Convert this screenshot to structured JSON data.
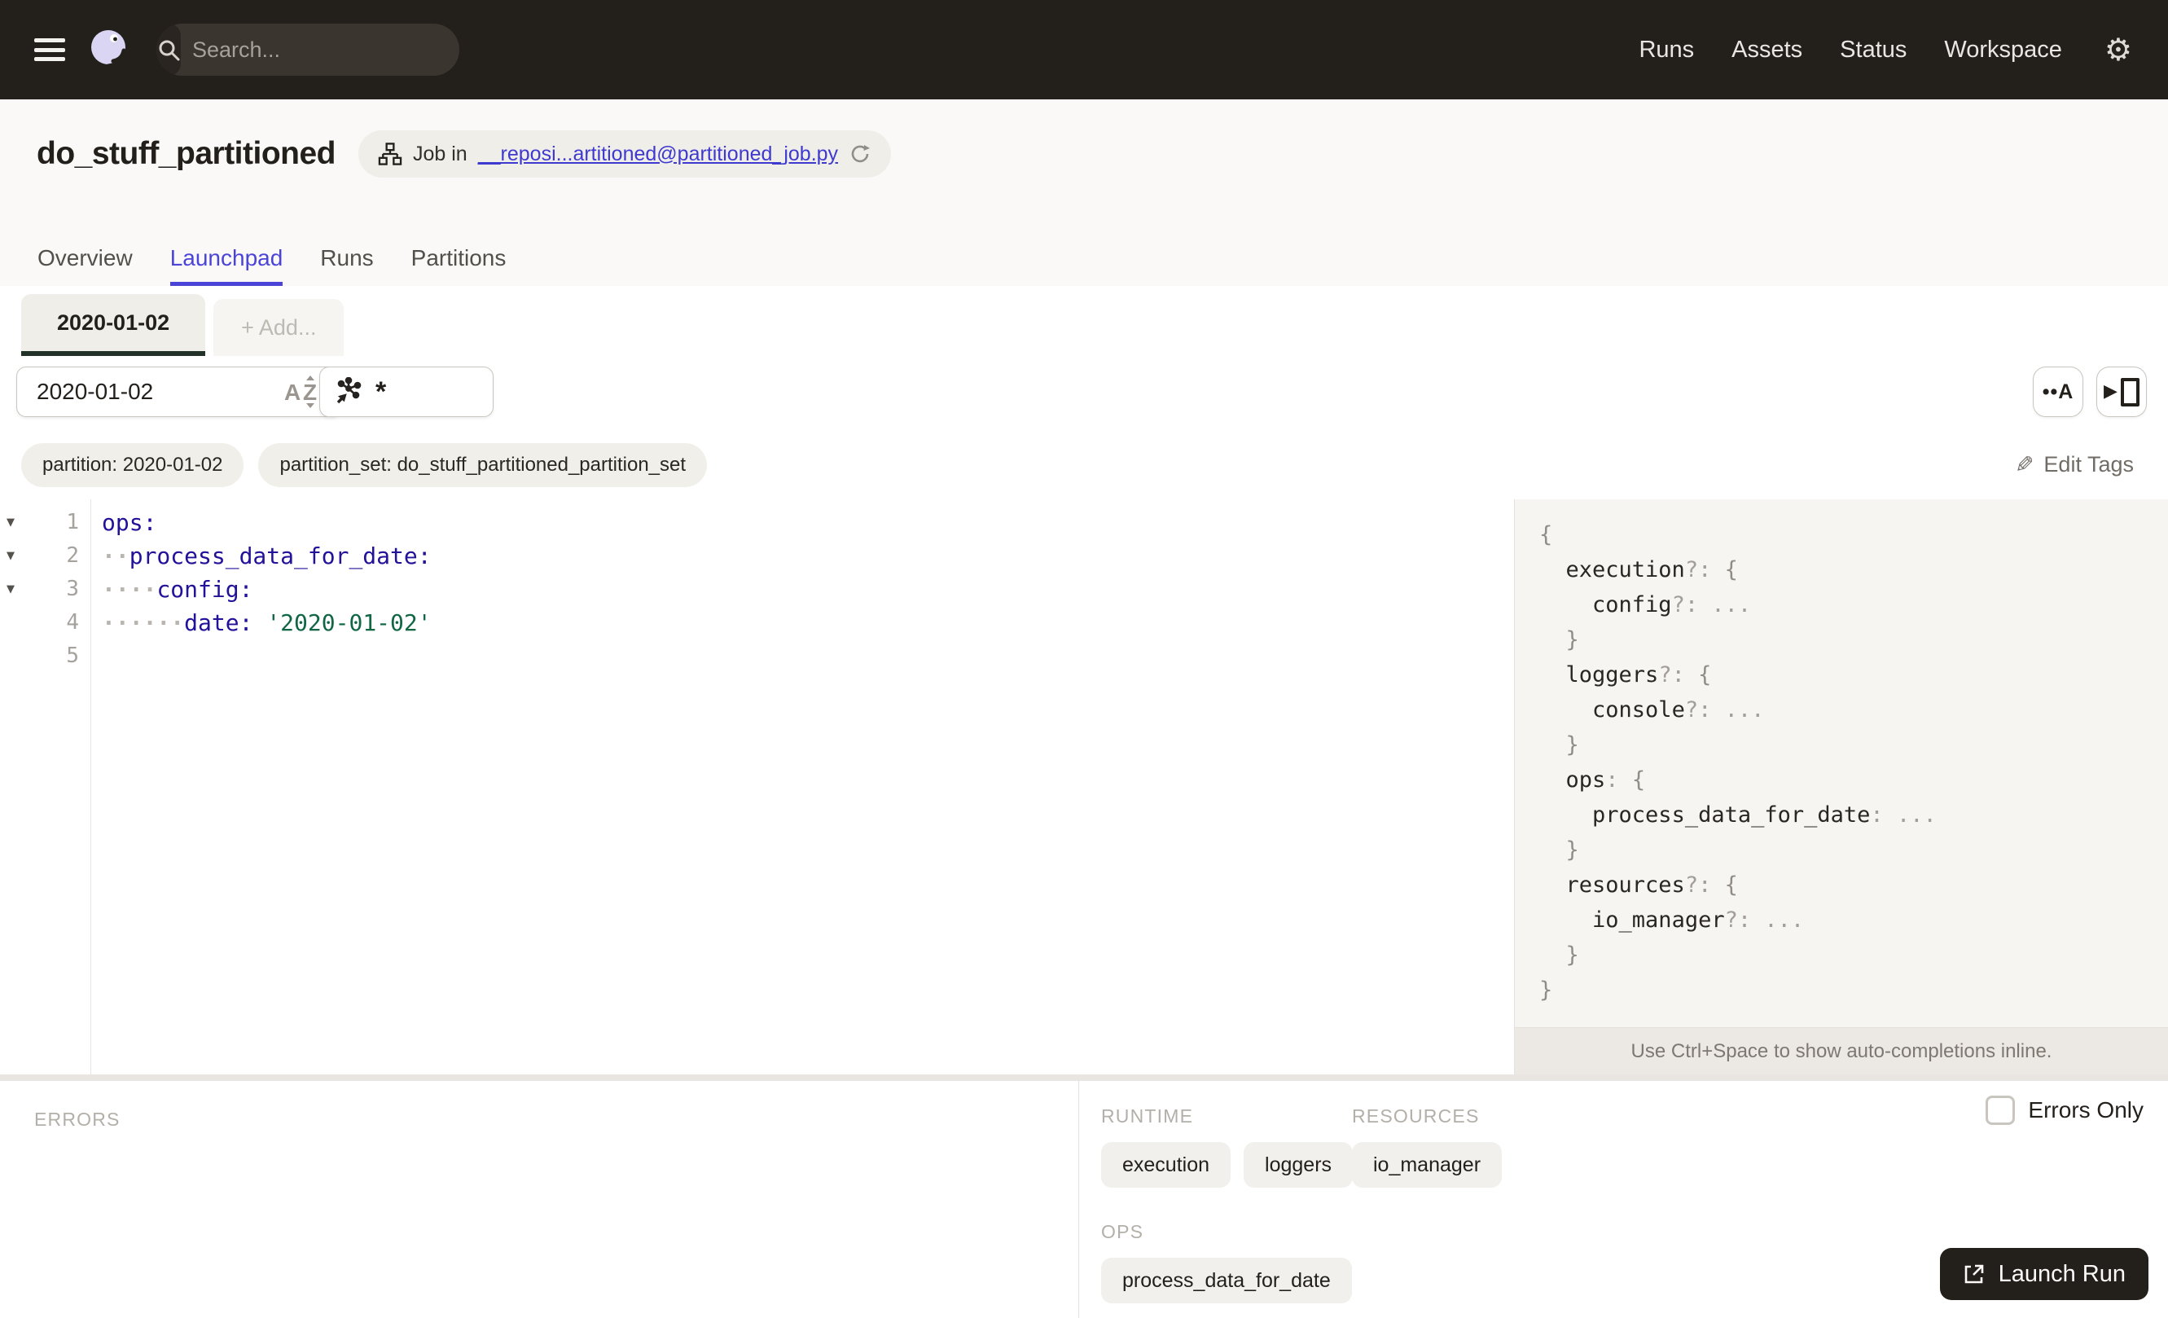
{
  "topnav": {
    "search_placeholder": "Search...",
    "search_shortcut": "/",
    "links": [
      "Runs",
      "Assets",
      "Status",
      "Workspace"
    ]
  },
  "header": {
    "title": "do_stuff_partitioned",
    "job_pill": {
      "prefix": "Job in",
      "link": "__reposi...artitioned@partitioned_job.py"
    },
    "tabs": [
      {
        "label": "Overview"
      },
      {
        "label": "Launchpad"
      },
      {
        "label": "Runs"
      },
      {
        "label": "Partitions"
      }
    ]
  },
  "launchpad": {
    "config_tab": "2020-01-02",
    "add_tab": "+ Add...",
    "partition_select": "2020-01-02",
    "op_select": "*",
    "tags": [
      "partition: 2020-01-02",
      "partition_set: do_stuff_partitioned_partition_set"
    ],
    "edit_tags": "Edit Tags",
    "editor": {
      "lines": [
        {
          "n": 1,
          "f": true,
          "segs": [
            [
              "k",
              "ops:"
            ]
          ]
        },
        {
          "n": 2,
          "f": true,
          "segs": [
            [
              "d",
              "··"
            ],
            [
              "k",
              "process_data_for_date:"
            ]
          ]
        },
        {
          "n": 3,
          "f": true,
          "segs": [
            [
              "d",
              "····"
            ],
            [
              "k",
              "config:"
            ]
          ]
        },
        {
          "n": 4,
          "f": false,
          "segs": [
            [
              "d",
              "······"
            ],
            [
              "k",
              "date:"
            ],
            [
              "p",
              " "
            ],
            [
              "s",
              "'2020-01-02'"
            ]
          ]
        },
        {
          "n": 5,
          "f": false,
          "segs": []
        }
      ]
    },
    "schema": {
      "lines": [
        [
          [
            "b",
            "{"
          ]
        ],
        [
          [
            "p",
            "  "
          ],
          [
            "n",
            "execution"
          ],
          [
            "q",
            "?:"
          ],
          [
            "p",
            " "
          ],
          [
            "b",
            "{"
          ]
        ],
        [
          [
            "p",
            "    "
          ],
          [
            "n",
            "config"
          ],
          [
            "q",
            "?:"
          ],
          [
            "p",
            " "
          ],
          [
            "e",
            "..."
          ]
        ],
        [
          [
            "p",
            "  "
          ],
          [
            "b",
            "}"
          ]
        ],
        [
          [
            "p",
            "  "
          ],
          [
            "n",
            "loggers"
          ],
          [
            "q",
            "?:"
          ],
          [
            "p",
            " "
          ],
          [
            "b",
            "{"
          ]
        ],
        [
          [
            "p",
            "    "
          ],
          [
            "n",
            "console"
          ],
          [
            "q",
            "?:"
          ],
          [
            "p",
            " "
          ],
          [
            "e",
            "..."
          ]
        ],
        [
          [
            "p",
            "  "
          ],
          [
            "b",
            "}"
          ]
        ],
        [
          [
            "p",
            "  "
          ],
          [
            "n",
            "ops"
          ],
          [
            "q",
            ":"
          ],
          [
            "p",
            " "
          ],
          [
            "b",
            "{"
          ]
        ],
        [
          [
            "p",
            "    "
          ],
          [
            "n",
            "process_data_for_date"
          ],
          [
            "q",
            ":"
          ],
          [
            "p",
            " "
          ],
          [
            "e",
            "..."
          ]
        ],
        [
          [
            "p",
            "  "
          ],
          [
            "b",
            "}"
          ]
        ],
        [
          [
            "p",
            "  "
          ],
          [
            "n",
            "resources"
          ],
          [
            "q",
            "?:"
          ],
          [
            "p",
            " "
          ],
          [
            "b",
            "{"
          ]
        ],
        [
          [
            "p",
            "    "
          ],
          [
            "n",
            "io_manager"
          ],
          [
            "q",
            "?:"
          ],
          [
            "p",
            " "
          ],
          [
            "e",
            "..."
          ]
        ],
        [
          [
            "p",
            "  "
          ],
          [
            "b",
            "}"
          ]
        ],
        [
          [
            "b",
            "}"
          ]
        ]
      ]
    },
    "hint": "Use Ctrl+Space to show auto-completions inline."
  },
  "bottom": {
    "errors_label": "ERRORS",
    "runtime_label": "RUNTIME",
    "runtime_items": [
      "execution",
      "loggers"
    ],
    "resources_label": "RESOURCES",
    "resources_items": [
      "io_manager"
    ],
    "ops_label": "OPS",
    "ops_items": [
      "process_data_for_date"
    ],
    "errors_only_label": "Errors Only",
    "launch_label": "Launch Run"
  },
  "colors": {
    "topbar_bg": "#231F1B",
    "accent_blue": "#4B44D8",
    "tab_underline_green": "#223229",
    "yaml_key": "#221199",
    "yaml_string": "#116644",
    "panel_bg": "#F7F5F2"
  }
}
